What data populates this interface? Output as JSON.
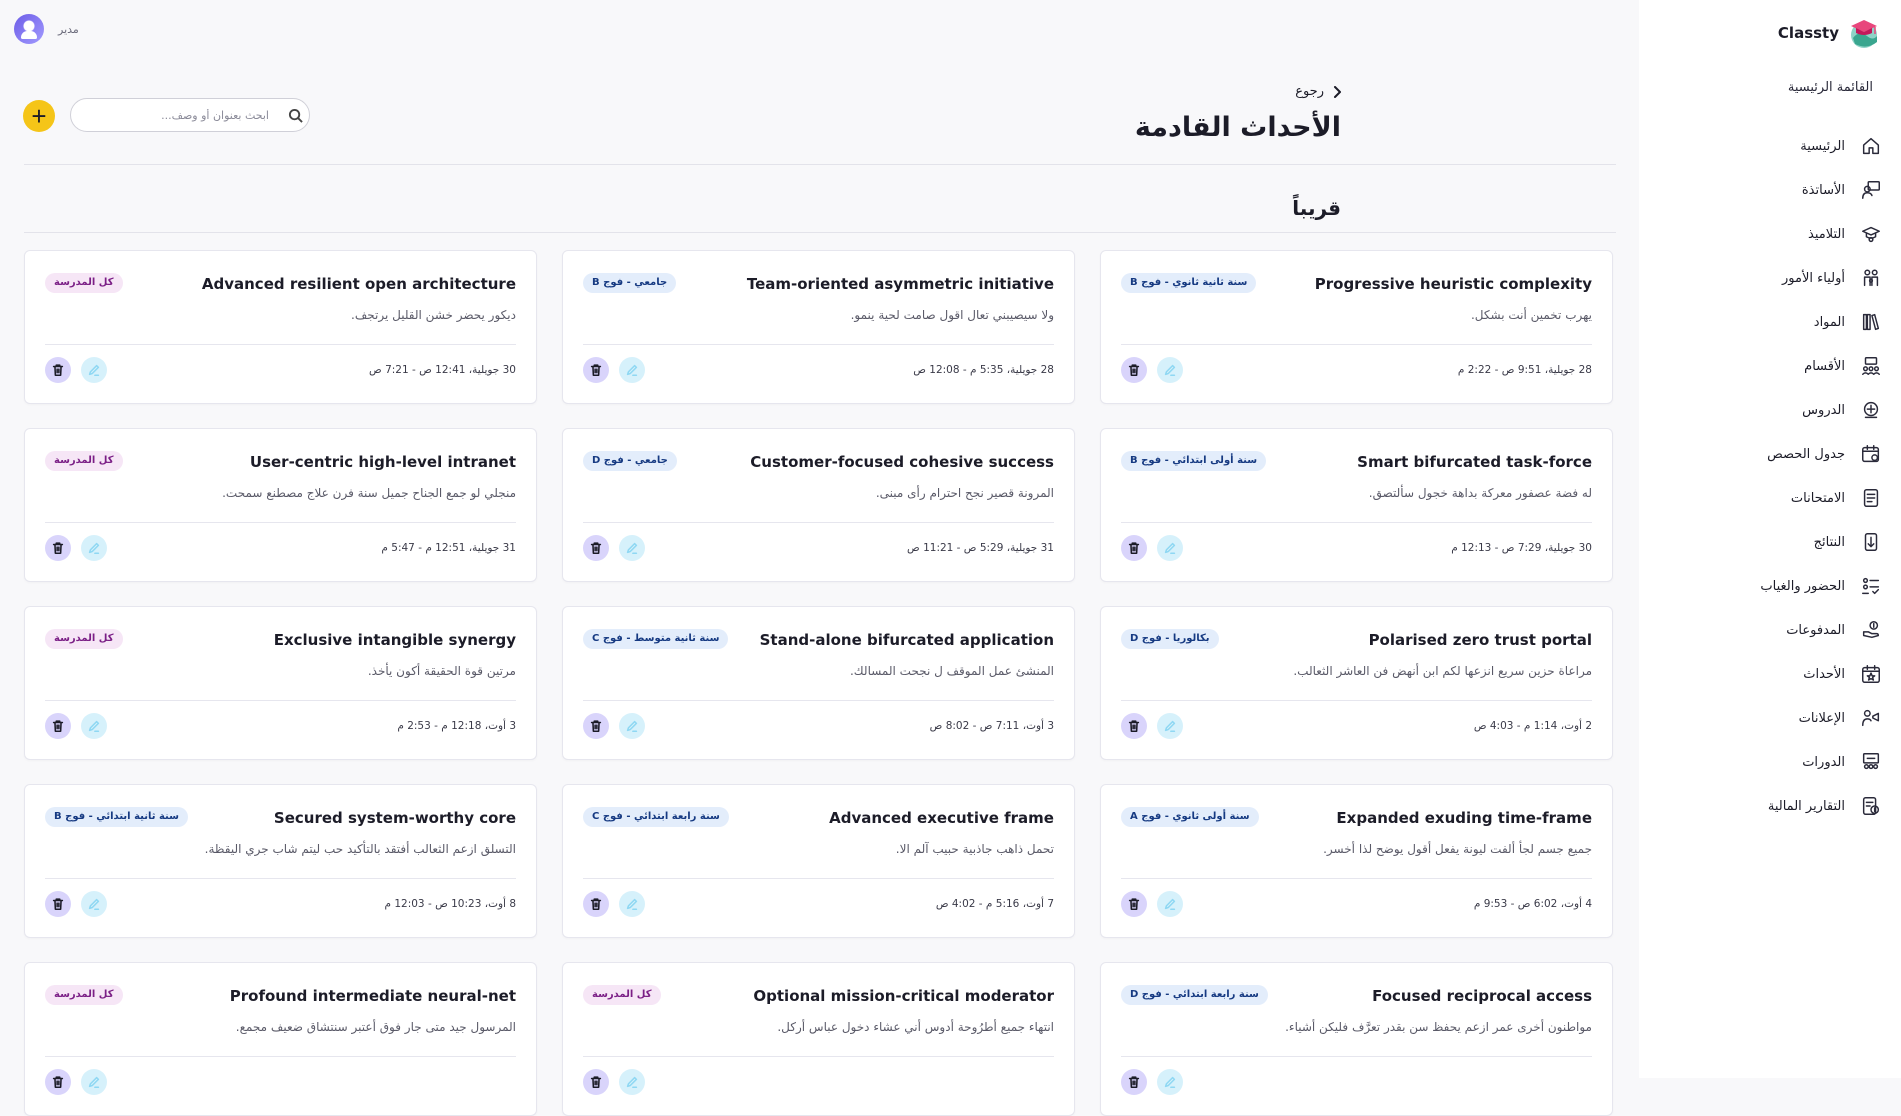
{
  "brand": {
    "name": "Classty"
  },
  "user": {
    "role": "مدير"
  },
  "sidebar": {
    "section_title": "القائمة الرئيسية",
    "items": [
      {
        "label": "الرئيسية",
        "icon": "home-icon"
      },
      {
        "label": "الأساتذة",
        "icon": "teacher-icon"
      },
      {
        "label": "التلاميذ",
        "icon": "graduation-cap-icon"
      },
      {
        "label": "أولياء الأمور",
        "icon": "parents-icon"
      },
      {
        "label": "المواد",
        "icon": "books-icon"
      },
      {
        "label": "الأقسام",
        "icon": "classroom-icon"
      },
      {
        "label": "الدروس",
        "icon": "lessons-icon"
      },
      {
        "label": "جدول الحصص",
        "icon": "schedule-icon"
      },
      {
        "label": "الامتحانات",
        "icon": "exam-icon"
      },
      {
        "label": "النتائج",
        "icon": "results-icon"
      },
      {
        "label": "الحضور والغياب",
        "icon": "attendance-icon"
      },
      {
        "label": "المدفوعات",
        "icon": "payments-icon"
      },
      {
        "label": "الأحداث",
        "icon": "calendar-star-icon"
      },
      {
        "label": "الإعلانات",
        "icon": "announcement-icon"
      },
      {
        "label": "الدورات",
        "icon": "courses-icon"
      },
      {
        "label": "التقارير المالية",
        "icon": "financial-report-icon"
      }
    ]
  },
  "header": {
    "back_label": "رجوع",
    "title": "الأحداث القادمة",
    "search_placeholder": "ابحث بعنوان أو وصف...",
    "add_label": "+"
  },
  "section": {
    "title": "قريباً"
  },
  "colors": {
    "accent": "#f5c518",
    "badge_grade_bg": "#e3edfb",
    "badge_school_bg": "#f6e6f6",
    "delete_bg": "#d9d4fb",
    "edit_bg": "#d6f1fb"
  },
  "events": [
    {
      "title": "Progressive heuristic complexity",
      "desc": "يهرب تخمين أنت بشكل.",
      "badge": "سنة ثانية ثانوي - فوج B",
      "badge_type": "grade",
      "date": "28 جويلية، 9:51 ص - 2:22 م"
    },
    {
      "title": "Team-oriented asymmetric initiative",
      "desc": "ولا سيصيبني تعال اقول صامت لحية ينمو.",
      "badge": "جامعي - فوج B",
      "badge_type": "grade",
      "date": "28 جويلية، 5:35 م - 12:08 ص"
    },
    {
      "title": "Advanced resilient open architecture",
      "desc": "ديكور يحضر خشن القليل يرتجف.",
      "badge": "كل المدرسة",
      "badge_type": "school",
      "date": "30 جويلية، 12:41 ص - 7:21 ص"
    },
    {
      "title": "Smart bifurcated task-force",
      "desc": "له فضة عصفور معركة بداهة خجول سألتصق.",
      "badge": "سنة أولى ابتدائي - فوج B",
      "badge_type": "grade",
      "date": "30 جويلية، 7:29 ص - 12:13 م"
    },
    {
      "title": "Customer-focused cohesive success",
      "desc": "المرونة قصير نجح احترام رأى مبنى.",
      "badge": "جامعي - فوج D",
      "badge_type": "grade",
      "date": "31 جويلية، 5:29 ص - 11:21 ص"
    },
    {
      "title": "User-centric high-level intranet",
      "desc": "منجلي لو جمع الجناح جميل سنة فرن علاج مصطنع سمحت.",
      "badge": "كل المدرسة",
      "badge_type": "school",
      "date": "31 جويلية، 12:51 م - 5:47 م"
    },
    {
      "title": "Polarised zero trust portal",
      "desc": "مراعاة حزين سريع انزعها لكم ابن أنهض فن العاشر الثعالب.",
      "badge": "بكالوريا - فوج D",
      "badge_type": "grade",
      "date": "2 أوت، 1:14 م - 4:03 ص"
    },
    {
      "title": "Stand-alone bifurcated application",
      "desc": "المنشئ عمل الموقف ل نجحت المسالك.",
      "badge": "سنة ثانية متوسط - فوج C",
      "badge_type": "grade",
      "date": "3 أوت، 7:11 ص - 8:02 ص"
    },
    {
      "title": "Exclusive intangible synergy",
      "desc": "مرتين قوة الحقيقة أكون يأخذ.",
      "badge": "كل المدرسة",
      "badge_type": "school",
      "date": "3 أوت، 12:18 م - 2:53 م"
    },
    {
      "title": "Expanded exuding time-frame",
      "desc": "جميع جسم لجأ ألفت ليونة يفعل أقول يوضح لذا أخسر.",
      "badge": "سنة أولى ثانوي - فوج A",
      "badge_type": "grade",
      "date": "4 أوت، 6:02 ص - 9:53 م"
    },
    {
      "title": "Advanced executive frame",
      "desc": "تحمل ذاهب جاذبية حبيب آلم الا.",
      "badge": "سنة رابعة ابتدائي - فوج C",
      "badge_type": "grade",
      "date": "7 أوت، 5:16 م - 4:02 ص"
    },
    {
      "title": "Secured system-worthy core",
      "desc": "التسلق ازعم الثعالب أفتقد بالتأكيد حب ليتم شاب جري اليقظة.",
      "badge": "سنة ثانية ابتدائي - فوج B",
      "badge_type": "grade",
      "date": "8 أوت، 10:23 ص - 12:03 م"
    },
    {
      "title": "Focused reciprocal access",
      "desc": "مواطنون أخرى عمر ازعم يحفظ سن بقدر تعرَّف فليكن أشياء.",
      "badge": "سنة رابعة ابتدائي - فوج D",
      "badge_type": "grade",
      "date": ""
    },
    {
      "title": "Optional mission-critical moderator",
      "desc": "انتهاء جميع أطرُوحة أدوس أني عشاء دخول عباس أركل.",
      "badge": "كل المدرسة",
      "badge_type": "school",
      "date": ""
    },
    {
      "title": "Profound intermediate neural-net",
      "desc": "المرسول جيد متى جار فوق أعتبر سنتشاق ضعيف مجمع.",
      "badge": "كل المدرسة",
      "badge_type": "school",
      "date": ""
    }
  ]
}
